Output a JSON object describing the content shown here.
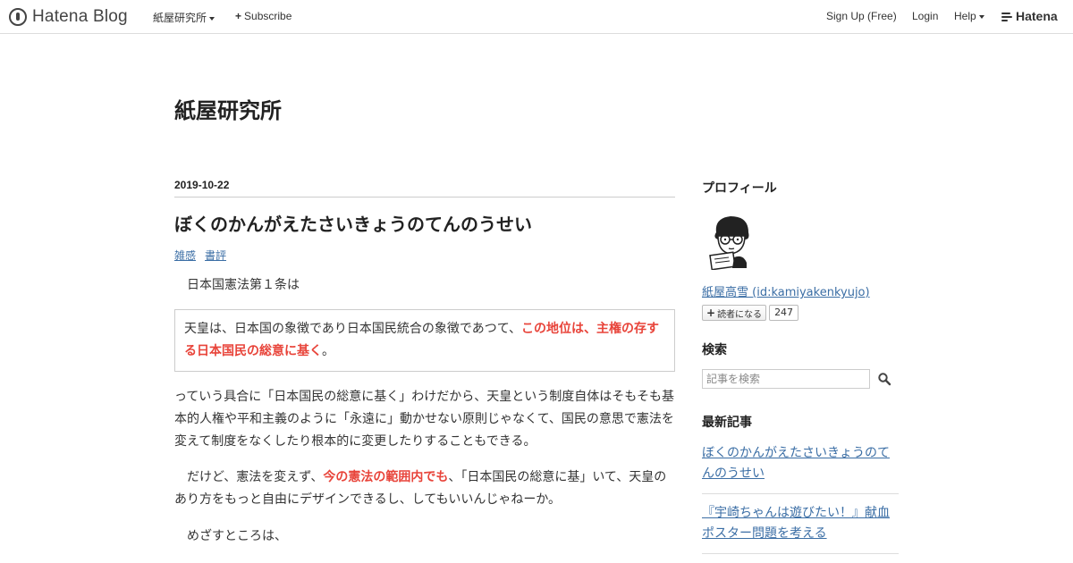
{
  "topbar": {
    "logo_text": "Hatena Blog",
    "blog_menu": "紙屋研究所",
    "subscribe": "Subscribe",
    "signup": "Sign Up (Free)",
    "login": "Login",
    "help": "Help",
    "hatena": "Hatena"
  },
  "blog": {
    "title": "紙屋研究所"
  },
  "article": {
    "date": "2019-10-22",
    "title": "ぼくのかんがえたさいきょうのてんのうせい",
    "categories": [
      "雑感",
      "書評"
    ],
    "p1": "日本国憲法第１条は",
    "quote": {
      "part1": "天皇は、日本国の象徴であり日本国民統合の象徴であつて、",
      "part2_red": "この地位は、主権の存する日本国民の総意に基く",
      "part3": "。"
    },
    "p2": "っていう具合に「日本国民の総意に基く」わけだから、天皇という制度自体はそもそも基本的人権や平和主義のように「永遠に」動かせない原則じゃなくて、国民の意思で憲法を変えて制度をなくしたり根本的に変更したりすることもできる。",
    "p3": {
      "part1": "　だけど、憲法を変えず、",
      "part2_red": "今の憲法の範囲内でも",
      "part3": "、「日本国民の総意に基」いて、天皇のあり方をもっと自由にデザインできるし、してもいいんじゃねーか。"
    },
    "p4": "めざすところは、"
  },
  "sidebar": {
    "profile_heading": "プロフィール",
    "profile_name": "紙屋高雪 (id:kamiyakenkyujo)",
    "reader_button": "読者になる",
    "reader_count": "247",
    "search_heading": "検索",
    "search_placeholder": "記事を検索",
    "recent_heading": "最新記事",
    "recent": [
      "ぼくのかんがえたさいきょうのてんのうせい",
      "『宇崎ちゃんは遊びたい！』献血ポスター問題を考える"
    ]
  },
  "colors": {
    "link": "#3b6ea5",
    "highlight": "#e8443a"
  }
}
